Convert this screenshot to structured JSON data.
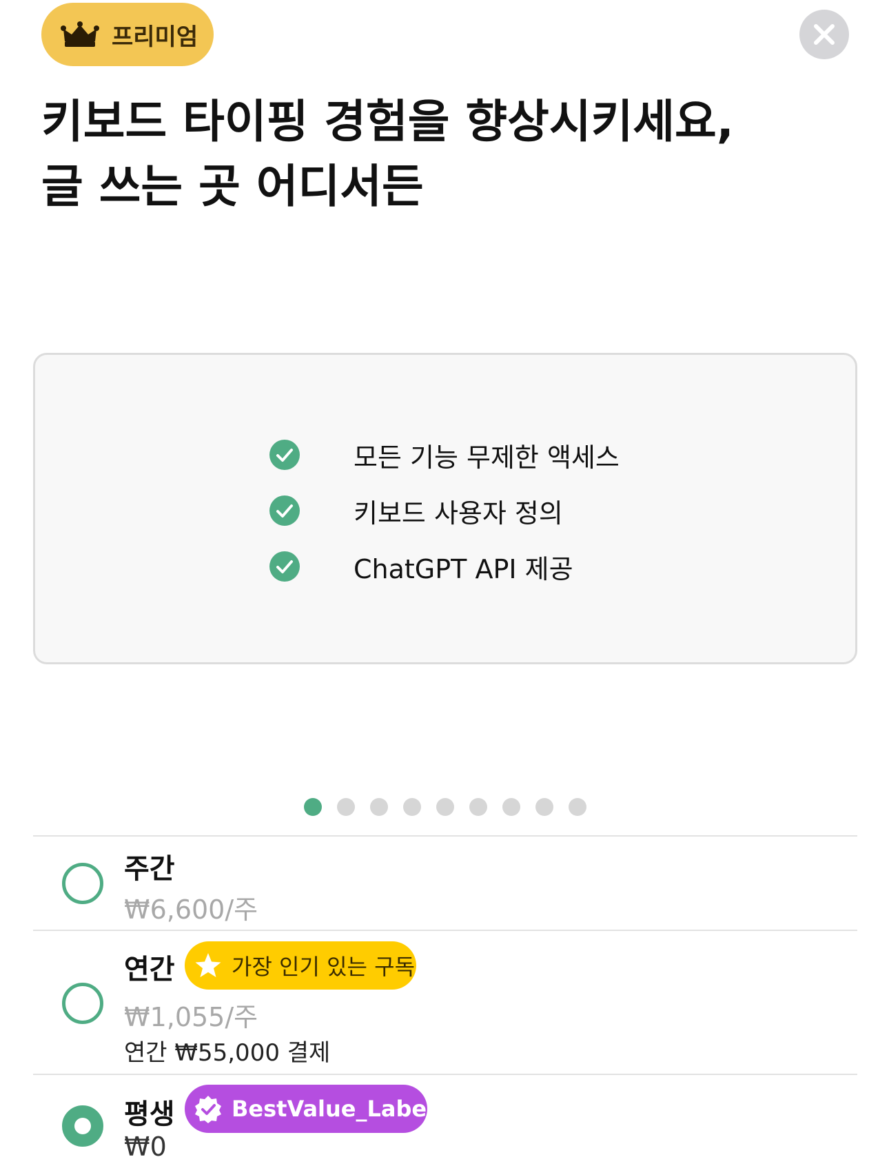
{
  "header": {
    "badge_label": "프리미엄",
    "badge_color": "#f3c654",
    "badge_icon": "crown-icon",
    "close_icon": "close-icon"
  },
  "title": {
    "line1": "키보드 타이핑 경험을 향상시키세요,",
    "line2": "글 쓰는 곳 어디서든"
  },
  "features": [
    {
      "label": "모든 기능 무제한 액세스",
      "icon": "check-circle-icon"
    },
    {
      "label": "키보드 사용자 정의",
      "icon": "check-circle-icon"
    },
    {
      "label": "ChatGPT API 제공",
      "icon": "check-circle-icon"
    }
  ],
  "carousel": {
    "page_count": 9,
    "active_page": 1
  },
  "plans": [
    {
      "name": "주간",
      "price": "₩6,600/주",
      "selected": false
    },
    {
      "name": "연간",
      "badge": "가장 인기 있는 구독",
      "badge_icon": "star-icon",
      "price": "₩1,055/주",
      "note": "연간 ₩55,000 결제",
      "selected": false
    },
    {
      "name": "평생",
      "badge": "BestValue_Label",
      "badge_icon": "verified-badge-icon",
      "price": "₩0",
      "selected": true
    }
  ],
  "colors": {
    "accent": "#4fac84",
    "popular_badge": "#ffcc00",
    "best_value_badge": "#b54ee0"
  }
}
